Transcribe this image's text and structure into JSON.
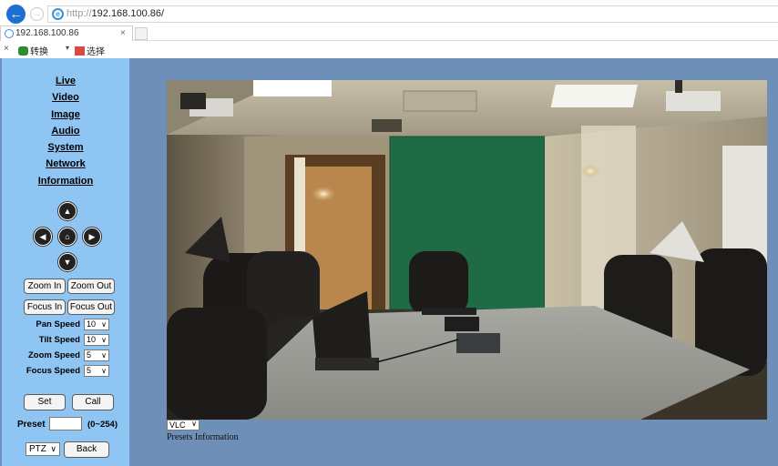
{
  "browser": {
    "url_scheme": "http://",
    "url_host": "192.168.100.86/",
    "tab_title": "192.168.100.86",
    "tab_close": "×",
    "toolbar_close": "×",
    "toolbar_convert": "转换",
    "toolbar_caret": "▾",
    "toolbar_select": "选择",
    "back_glyph": "←",
    "forward_glyph": "→"
  },
  "nav": {
    "items": [
      "Live",
      "Video",
      "Image",
      "Audio",
      "System",
      "Network",
      "Information"
    ]
  },
  "ptz": {
    "up_icon": "▲",
    "left_icon": "◀",
    "home_icon": "⌂",
    "right_icon": "▶",
    "down_icon": "▼",
    "zoom_in": "Zoom In",
    "zoom_out": "Zoom Out",
    "focus_in": "Focus In",
    "focus_out": "Focus Out"
  },
  "speeds": {
    "pan_label": "Pan Speed",
    "pan_value": "10",
    "tilt_label": "Tilt Speed",
    "tilt_value": "10",
    "zoom_label": "Zoom Speed",
    "zoom_value": "5",
    "focus_label": "Focus Speed",
    "focus_value": "5"
  },
  "preset": {
    "set": "Set",
    "call": "Call",
    "label": "Preset",
    "value": "",
    "range": "(0~254)"
  },
  "footer": {
    "mode_value": "PTZ",
    "back": "Back"
  },
  "video": {
    "stream_value": "VLC",
    "presets_info": "Presets Information"
  },
  "colors": {
    "page_bg": "#6d8fb8",
    "sidebar_bg": "#8fc5f2",
    "accent": "#1e6fd0"
  }
}
